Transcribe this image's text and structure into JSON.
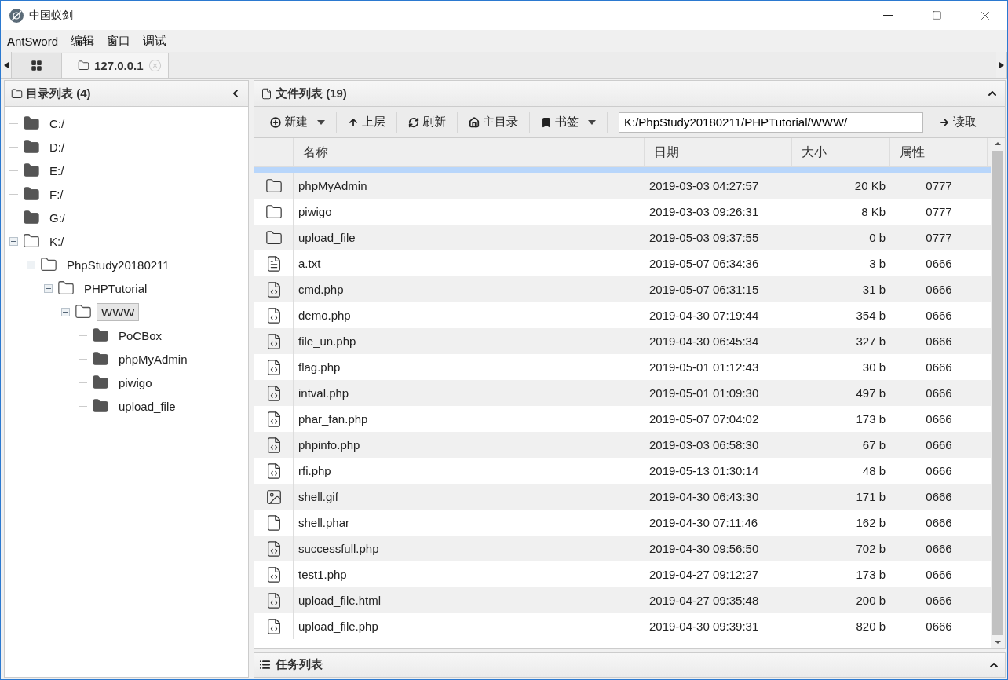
{
  "window": {
    "title": "中国蚁剑"
  },
  "menu": [
    "AntSword",
    "编辑",
    "窗口",
    "调试"
  ],
  "tabs": [
    {
      "kind": "home",
      "selected": false
    },
    {
      "kind": "folder",
      "label": "127.0.0.1",
      "selected": true
    }
  ],
  "dir_panel": {
    "title": "目录列表 (4)",
    "tree": [
      {
        "label": "C:/",
        "expanded": false,
        "selected": false
      },
      {
        "label": "D:/",
        "expanded": false,
        "selected": false
      },
      {
        "label": "E:/",
        "expanded": false,
        "selected": false
      },
      {
        "label": "F:/",
        "expanded": false,
        "selected": false
      },
      {
        "label": "G:/",
        "expanded": false,
        "selected": false
      },
      {
        "label": "K:/",
        "expanded": true,
        "selected": false,
        "children": [
          {
            "label": "PhpStudy20180211",
            "expanded": true,
            "selected": false,
            "children": [
              {
                "label": "PHPTutorial",
                "expanded": true,
                "selected": false,
                "children": [
                  {
                    "label": "WWW",
                    "expanded": true,
                    "selected": true,
                    "children": [
                      {
                        "label": "PoCBox",
                        "expanded": false,
                        "selected": false
                      },
                      {
                        "label": "phpMyAdmin",
                        "expanded": false,
                        "selected": false
                      },
                      {
                        "label": "piwigo",
                        "expanded": false,
                        "selected": false
                      },
                      {
                        "label": "upload_file",
                        "expanded": false,
                        "selected": false
                      }
                    ]
                  }
                ]
              }
            ]
          }
        ]
      }
    ]
  },
  "file_panel": {
    "title": "文件列表 (19)",
    "toolbar": [
      {
        "label": "新建",
        "has_menu": true
      },
      {
        "label": "上层",
        "has_menu": false
      },
      {
        "label": "刷新",
        "has_menu": false
      },
      {
        "label": "主目录",
        "has_menu": false
      },
      {
        "label": "书签",
        "has_menu": true
      }
    ],
    "path": "K:/PhpStudy20180211/PHPTutorial/WWW/",
    "read_button": "读取",
    "columns": [
      "名称",
      "日期",
      "大小",
      "属性"
    ],
    "rows": [
      {
        "kind": "folder",
        "name": "phpMyAdmin",
        "date": "2019-03-03 04:27:57",
        "size": "20 Kb",
        "attr": "0777"
      },
      {
        "kind": "folder",
        "name": "piwigo",
        "date": "2019-03-03 09:26:31",
        "size": "8 Kb",
        "attr": "0777"
      },
      {
        "kind": "folder",
        "name": "upload_file",
        "date": "2019-05-03 09:37:55",
        "size": "0 b",
        "attr": "0777"
      },
      {
        "kind": "text",
        "name": "a.txt",
        "date": "2019-05-07 06:34:36",
        "size": "3 b",
        "attr": "0666"
      },
      {
        "kind": "code",
        "name": "cmd.php",
        "date": "2019-05-07 06:31:15",
        "size": "31 b",
        "attr": "0666"
      },
      {
        "kind": "code",
        "name": "demo.php",
        "date": "2019-04-30 07:19:44",
        "size": "354 b",
        "attr": "0666"
      },
      {
        "kind": "code",
        "name": "file_un.php",
        "date": "2019-04-30 06:45:34",
        "size": "327 b",
        "attr": "0666"
      },
      {
        "kind": "code",
        "name": "flag.php",
        "date": "2019-05-01 01:12:43",
        "size": "30 b",
        "attr": "0666"
      },
      {
        "kind": "code",
        "name": "intval.php",
        "date": "2019-05-01 01:09:30",
        "size": "497 b",
        "attr": "0666"
      },
      {
        "kind": "code",
        "name": "phar_fan.php",
        "date": "2019-05-07 07:04:02",
        "size": "173 b",
        "attr": "0666"
      },
      {
        "kind": "code",
        "name": "phpinfo.php",
        "date": "2019-03-03 06:58:30",
        "size": "67 b",
        "attr": "0666"
      },
      {
        "kind": "code",
        "name": "rfi.php",
        "date": "2019-05-13 01:30:14",
        "size": "48 b",
        "attr": "0666"
      },
      {
        "kind": "image",
        "name": "shell.gif",
        "date": "2019-04-30 06:43:30",
        "size": "171 b",
        "attr": "0666"
      },
      {
        "kind": "file",
        "name": "shell.phar",
        "date": "2019-04-30 07:11:46",
        "size": "162 b",
        "attr": "0666"
      },
      {
        "kind": "code",
        "name": "successfull.php",
        "date": "2019-04-30 09:56:50",
        "size": "702 b",
        "attr": "0666"
      },
      {
        "kind": "code",
        "name": "test1.php",
        "date": "2019-04-27 09:12:27",
        "size": "173 b",
        "attr": "0666"
      },
      {
        "kind": "code",
        "name": "upload_file.html",
        "date": "2019-04-27 09:35:48",
        "size": "200 b",
        "attr": "0666"
      },
      {
        "kind": "code",
        "name": "upload_file.php",
        "date": "2019-04-30 09:39:31",
        "size": "820 b",
        "attr": "0666"
      }
    ]
  },
  "task_panel": {
    "title": "任务列表"
  }
}
